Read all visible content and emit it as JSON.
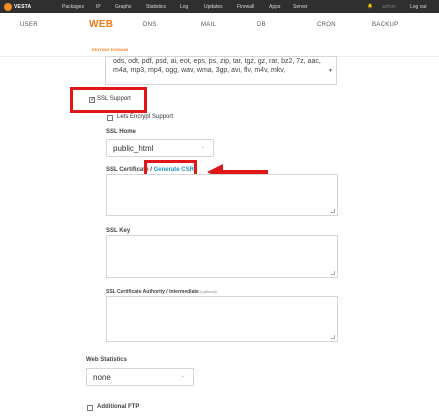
{
  "topbar": {
    "logo": "VESTA",
    "nav": [
      "Packages",
      "IP",
      "Graphs",
      "Statistics",
      "Log",
      "Updates",
      "Firewall",
      "Apps",
      "Server"
    ],
    "user": "admin",
    "logout": "Log out"
  },
  "main_nav": {
    "tabs": [
      "USER",
      "WEB",
      "DNS",
      "MAIL",
      "DB",
      "CRON",
      "BACKUP"
    ],
    "active": "WEB",
    "subtitle": "EDITING DOMAIN"
  },
  "extensions_value": "ods, odt, pdf, psd, ai, eot, eps, ps, zip, tar, tgz, gz, rar, bz2, 7z, aac, m4a, mp3, mp4, ogg, wav, wma, 3gp, avi, flv, m4v, mkv,",
  "ssl": {
    "support_label": "SSL Support",
    "lets_encrypt_label": "Lets Encrypt Support",
    "home_label": "SSL Home",
    "home_value": "public_html",
    "cert_label": "SSL Certificate",
    "cert_sep": " / ",
    "generate_csr": "Generate CSR",
    "key_label": "SSL Key",
    "ca_label": "SSL Certificate Authority / Intermediate",
    "ca_optional": "(optional)"
  },
  "stats": {
    "label": "Web Statistics",
    "value": "none"
  },
  "ftp": {
    "label": "Additional FTP"
  },
  "colors": {
    "accent": "#f47a16",
    "link": "#1f9ab9",
    "annotation": "#e11616",
    "topbar": "#2f2f2f"
  }
}
